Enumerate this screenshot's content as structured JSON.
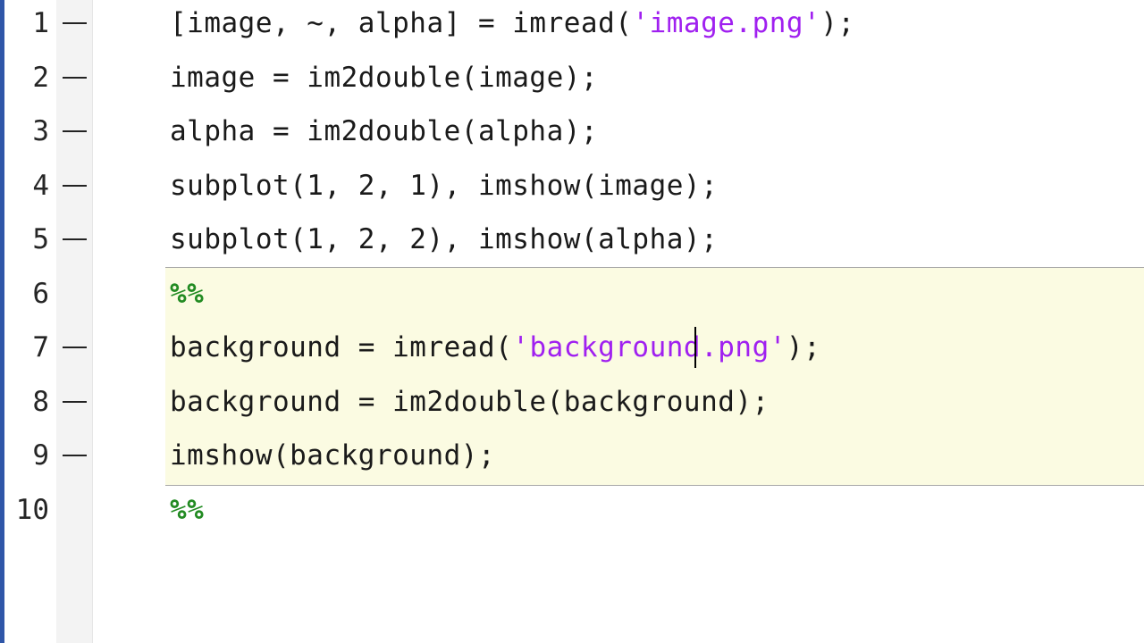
{
  "editor": {
    "lines": [
      {
        "number": "1",
        "has_marker": true,
        "segments": [
          {
            "text": "[image, ~, alpha] = imread(",
            "kind": "plain"
          },
          {
            "text": "'image.png'",
            "kind": "string"
          },
          {
            "text": ");",
            "kind": "plain"
          }
        ]
      },
      {
        "number": "2",
        "has_marker": true,
        "segments": [
          {
            "text": "image = im2double(image);",
            "kind": "plain"
          }
        ]
      },
      {
        "number": "3",
        "has_marker": true,
        "segments": [
          {
            "text": "alpha = im2double(alpha);",
            "kind": "plain"
          }
        ]
      },
      {
        "number": "4",
        "has_marker": true,
        "segments": [
          {
            "text": "subplot(1, 2, 1), imshow(image);",
            "kind": "plain"
          }
        ]
      },
      {
        "number": "5",
        "has_marker": true,
        "segments": [
          {
            "text": "subplot(1, 2, 2), imshow(alpha);",
            "kind": "plain"
          }
        ]
      },
      {
        "number": "6",
        "has_marker": false,
        "segments": [
          {
            "text": "%%",
            "kind": "cell"
          }
        ]
      },
      {
        "number": "7",
        "has_marker": true,
        "segments": [
          {
            "text": "background = imread(",
            "kind": "plain"
          },
          {
            "text": "'background.png'",
            "kind": "string"
          },
          {
            "text": ");",
            "kind": "plain"
          }
        ]
      },
      {
        "number": "8",
        "has_marker": true,
        "segments": [
          {
            "text": "background = im2double(background);",
            "kind": "plain"
          }
        ]
      },
      {
        "number": "9",
        "has_marker": true,
        "segments": [
          {
            "text": "imshow(background);",
            "kind": "plain"
          }
        ]
      },
      {
        "number": "10",
        "has_marker": false,
        "segments": [
          {
            "text": "%%",
            "kind": "cell"
          }
        ]
      }
    ],
    "cursor": {
      "line": "7",
      "column": "16"
    },
    "colors": {
      "string": "#a020f0",
      "cell_marker": "#228b22",
      "cell_highlight": "#fbfbe2",
      "window_edge": "#2f56a8"
    }
  }
}
